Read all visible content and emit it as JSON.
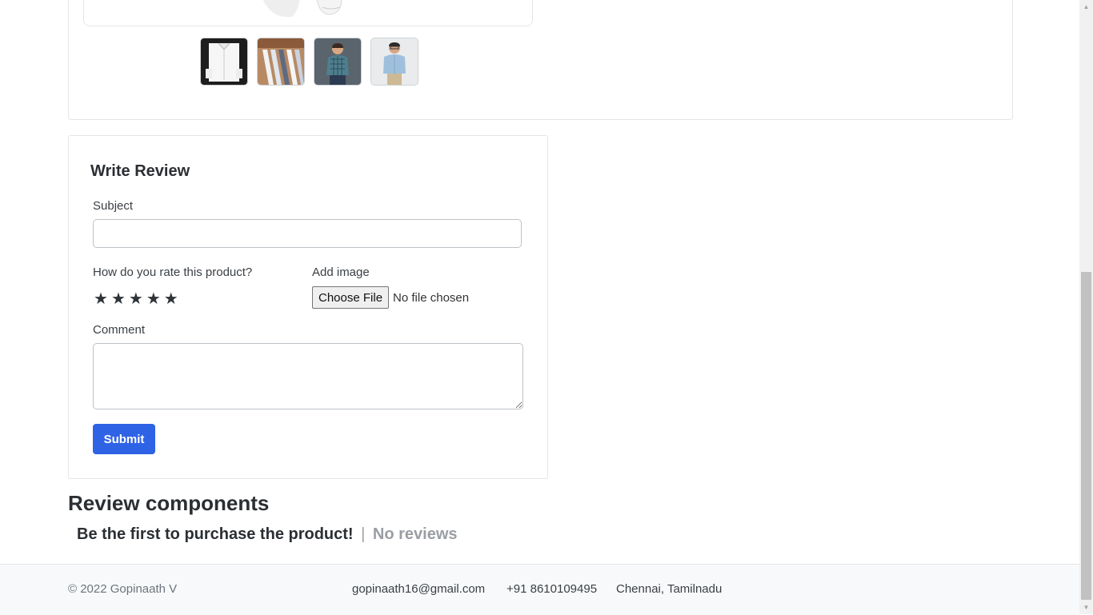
{
  "product": {
    "thumbnails": [
      {
        "icon": "white-shirt-folded-image"
      },
      {
        "icon": "shirts-on-hangers-image"
      },
      {
        "icon": "man-checked-shirt-image"
      },
      {
        "icon": "man-blue-shirt-image"
      }
    ]
  },
  "review_form": {
    "title": "Write Review",
    "subject_label": "Subject",
    "subject_value": "",
    "rating_label": "How do you rate this product?",
    "stars": [
      "★",
      "★",
      "★",
      "★",
      "★"
    ],
    "image_label": "Add image",
    "file_button": "Choose File",
    "file_status": "No file chosen",
    "comment_label": "Comment",
    "comment_value": "",
    "submit_label": "Submit"
  },
  "reviews": {
    "heading": "Review components",
    "empty_message": "Be the first to purchase the product!",
    "separator": "|",
    "no_reviews": "No reviews"
  },
  "footer": {
    "copyright": "© 2022 Gopinaath V",
    "email": "gopinaath16@gmail.com",
    "phone": "+91 8610109495",
    "location": "Chennai, Tamilnadu"
  },
  "colors": {
    "primary_button": "#2f63e6",
    "footer_bg": "#f8f9fa"
  }
}
